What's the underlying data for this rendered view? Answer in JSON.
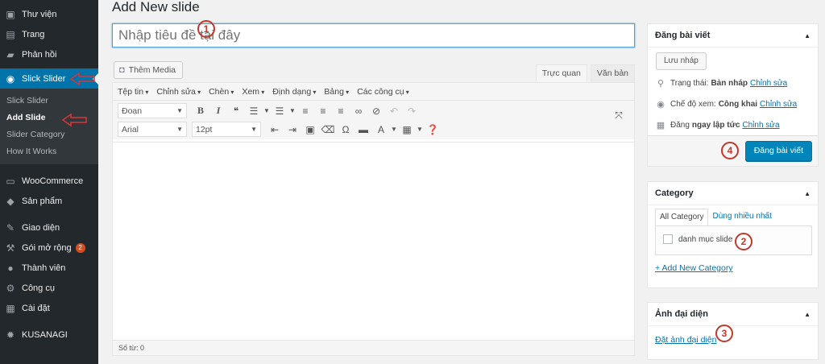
{
  "sidebar": {
    "items_top": [
      {
        "label": "Thư viện",
        "icon": "media-icon"
      },
      {
        "label": "Trang",
        "icon": "page-icon"
      },
      {
        "label": "Phản hồi",
        "icon": "comment-icon"
      }
    ],
    "active_item": {
      "label": "Slick Slider",
      "icon": "slider-icon"
    },
    "submenu": [
      "Slick Slider",
      "Add Slide",
      "Slider Category",
      "How It Works"
    ],
    "items_bottom": [
      {
        "label": "WooCommerce",
        "icon": "woo-icon"
      },
      {
        "label": "Sản phẩm",
        "icon": "product-icon"
      },
      {
        "label": "Giao diện",
        "icon": "brush-icon"
      },
      {
        "label": "Gói mở rộng",
        "icon": "plugin-icon"
      },
      {
        "label": "Thành viên",
        "icon": "user-icon"
      },
      {
        "label": "Công cụ",
        "icon": "wrench-icon"
      },
      {
        "label": "Cài đặt",
        "icon": "settings-icon"
      },
      {
        "label": "KUSANAGI",
        "icon": "gear-icon"
      }
    ],
    "plugins_badge": "2"
  },
  "main": {
    "page_title": "Add New slide",
    "title_placeholder": "Nhập tiêu đề tại đây",
    "add_media_label": "Thêm Media",
    "tab_visual": "Trực quan",
    "tab_text": "Văn bản",
    "menubar": [
      "Tệp tin",
      "Chỉnh sửa",
      "Chèn",
      "Xem",
      "Định dạng",
      "Bảng",
      "Các công cụ"
    ],
    "format_select": "Đoạn",
    "font_select": "Arial",
    "size_select": "12pt",
    "word_count": "Số từ: 0"
  },
  "publish": {
    "heading": "Đăng bài viết",
    "save_draft": "Lưu nháp",
    "status_label": "Trạng thái:",
    "status_value": "Bản nháp",
    "visibility_label": "Chế độ xem:",
    "visibility_value": "Công khai",
    "schedule_label": "Đăng",
    "schedule_value": "ngay lập tức",
    "edit_link": "Chỉnh sửa",
    "publish_button": "Đăng bài viết"
  },
  "category": {
    "heading": "Category",
    "tab_all": "All Category",
    "tab_popular": "Dùng nhiều nhất",
    "item": "danh mục slide",
    "add_new": "+ Add New Category"
  },
  "featured_image": {
    "heading": "Ảnh đại diện",
    "set_link": "Đặt ảnh đại diện"
  },
  "annotations": [
    "1",
    "2",
    "3",
    "4"
  ],
  "colors": {
    "sidebar": "#23282d",
    "active": "#0073aa",
    "primary": "#0085ba",
    "annotation": "#c0392b"
  }
}
